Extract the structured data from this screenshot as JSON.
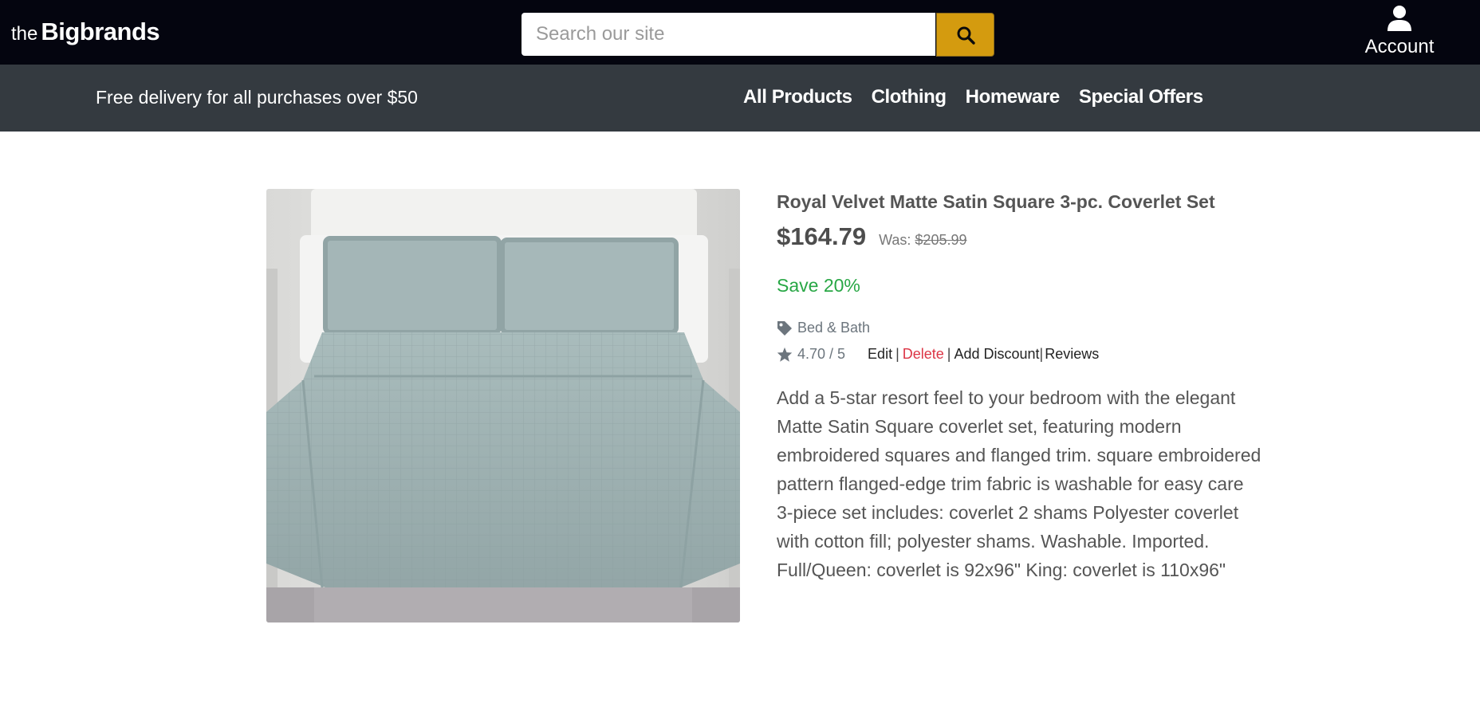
{
  "header": {
    "logo_prefix": "the",
    "logo_brand": "Bigbrands",
    "search_placeholder": "Search our site",
    "account_label": "Account"
  },
  "navbar": {
    "promo": "Free delivery for all purchases over $50",
    "links": [
      "All Products",
      "Clothing",
      "Homeware",
      "Special Offers"
    ]
  },
  "product": {
    "title": "Royal Velvet Matte Satin Square 3-pc. Coverlet Set",
    "price": "$164.79",
    "was_label": "Was:",
    "was_price": "$205.99",
    "save": "Save 20%",
    "category": "Bed & Bath",
    "rating": "4.70 / 5",
    "actions": {
      "edit": "Edit",
      "delete": "Delete",
      "add_discount": "Add Discount",
      "reviews": "Reviews"
    },
    "description": "Add a 5-star resort feel to your bedroom with the elegant Matte Satin Square coverlet set, featuring modern embroidered squares and flanged trim. square embroidered pattern flanged-edge trim fabric is washable for easy care 3-piece set includes: coverlet 2 shams Polyester coverlet with cotton fill; polyester shams. Washable. Imported. Full/Queen: coverlet is 92x96\" King: coverlet is 110x96\""
  },
  "colors": {
    "topbar": "#04050f",
    "navbar": "#343a40",
    "search_button": "#d49b0f",
    "save_green": "#28a745",
    "delete_red": "#dc3545"
  },
  "icons": [
    "search-icon",
    "user-icon",
    "tag-icon",
    "star-icon"
  ]
}
